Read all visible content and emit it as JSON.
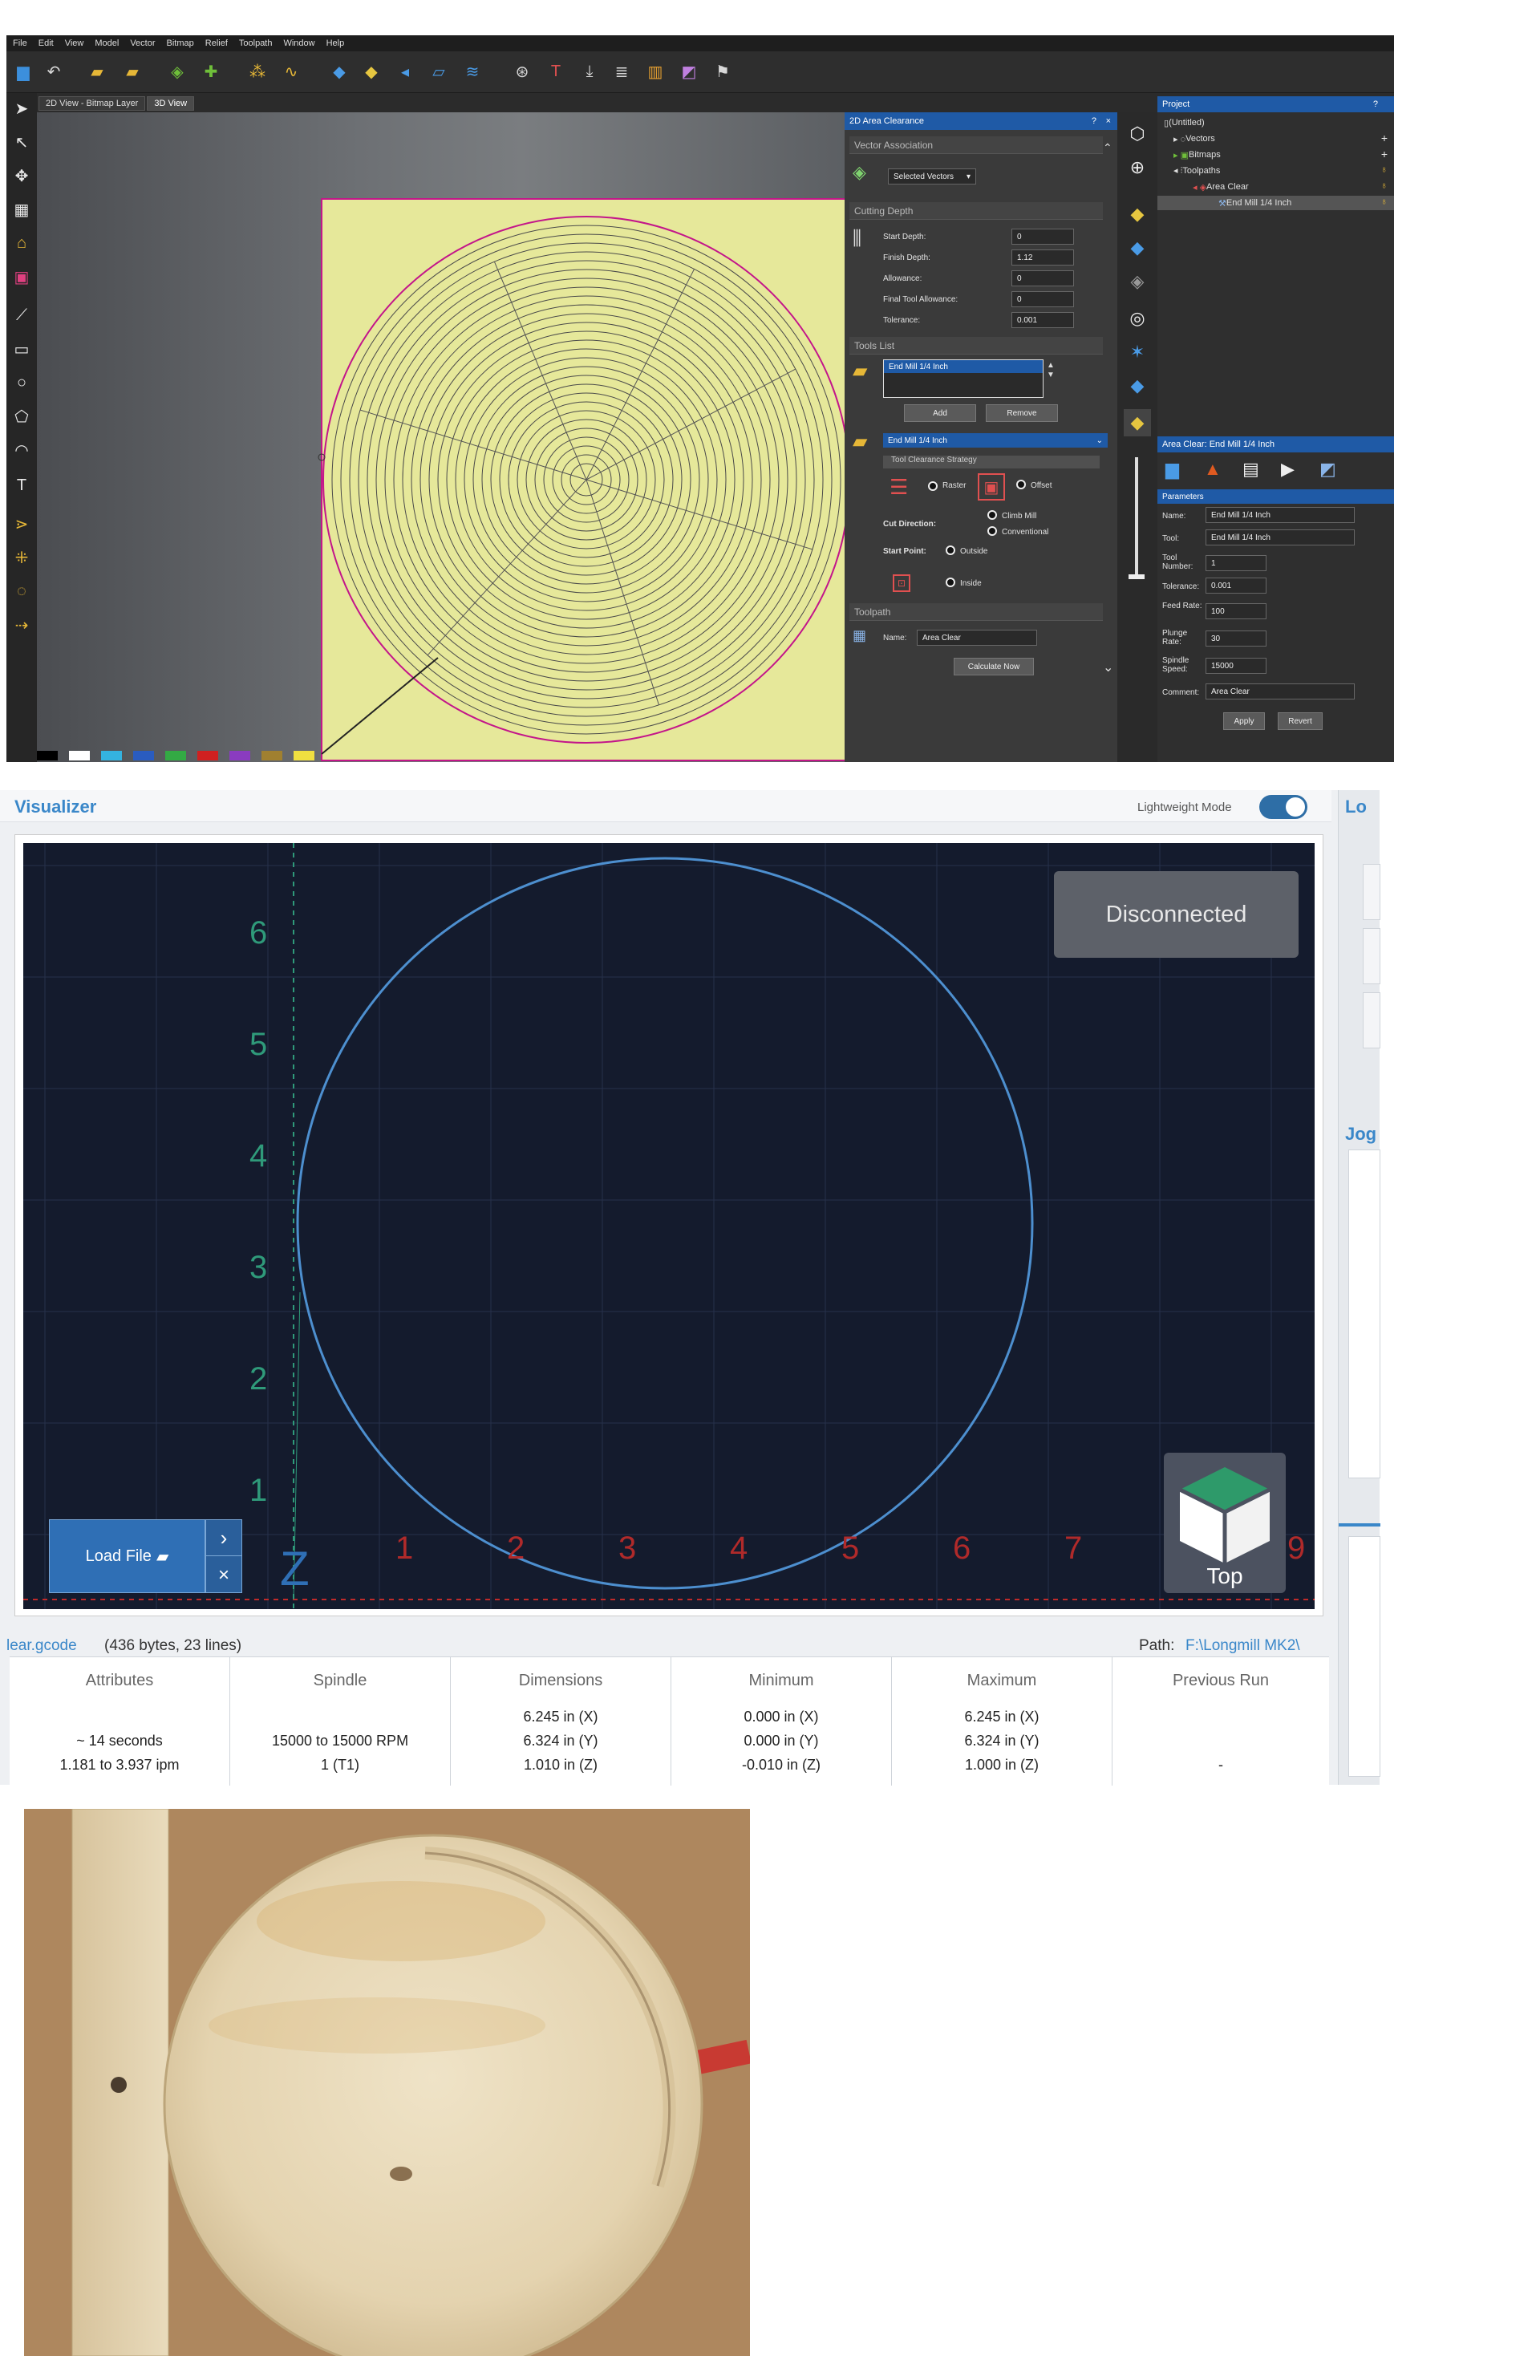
{
  "app": {
    "menu": [
      "File",
      "Edit",
      "View",
      "Model",
      "Vector",
      "Bitmap",
      "Relief",
      "Toolpath",
      "Window",
      "Help"
    ],
    "view_tabs": [
      "2D View - Bitmap Layer",
      "3D View"
    ],
    "area_clearance": {
      "title": "2D Area Clearance",
      "help": "?",
      "close": "×",
      "vector_association": "Vector Association",
      "selected_vectors": "Selected Vectors",
      "cutting_depth": "Cutting Depth",
      "fields": [
        {
          "label": "Start Depth:",
          "value": "0"
        },
        {
          "label": "Finish Depth:",
          "value": "1.12"
        },
        {
          "label": "Allowance:",
          "value": "0"
        },
        {
          "label": "Final Tool Allowance:",
          "value": "0"
        },
        {
          "label": "Tolerance:",
          "value": "0.001"
        }
      ],
      "tools_list": "Tools List",
      "tool_item": "End Mill 1/4 Inch",
      "add": "Add",
      "remove": "Remove",
      "tool_header": "End Mill 1/4 Inch",
      "strategy": "Tool Clearance Strategy",
      "raster": "Raster",
      "offset": "Offset",
      "cut_direction": "Cut Direction:",
      "climb_mill": "Climb Mill",
      "conventional": "Conventional",
      "start_point": "Start Point:",
      "outside": "Outside",
      "inside": "Inside",
      "toolpath": "Toolpath",
      "name_label": "Name:",
      "name_value": "Area Clear",
      "calculate": "Calculate Now"
    },
    "project": {
      "title": "Project",
      "help": "?",
      "items": [
        "(Untitled)",
        "Vectors",
        "Bitmaps",
        "Toolpaths",
        "Area Clear",
        "End Mill 1/4 Inch"
      ]
    },
    "params": {
      "title": "Area Clear: End Mill 1/4 Inch",
      "section": "Parameters",
      "rows": [
        {
          "label": "Name:",
          "value": "End Mill 1/4 Inch"
        },
        {
          "label": "Tool:",
          "value": "End Mill 1/4 Inch"
        },
        {
          "label": "Tool Number:",
          "value": "1"
        },
        {
          "label": "Tolerance:",
          "value": "0.001"
        },
        {
          "label": "Feed Rate:",
          "value": "100"
        },
        {
          "label": "Plunge Rate:",
          "value": "30"
        },
        {
          "label": "Spindle Speed:",
          "value": "15000"
        },
        {
          "label": "Comment:",
          "value": "Area Clear"
        }
      ],
      "apply": "Apply",
      "revert": "Revert"
    },
    "colors": {
      "accent": "#1f5aa6",
      "material": "#e6e89a",
      "toolpath": "#c3168a"
    }
  },
  "visualizer": {
    "title": "Visualizer",
    "lightweight_mode": "Lightweight Mode",
    "lightweight_on": true,
    "status": "Disconnected",
    "load_file": "Load File",
    "cube_label": "Top",
    "y_ticks": [
      "1",
      "2",
      "3",
      "4",
      "5",
      "6"
    ],
    "x_ticks": [
      "1",
      "2",
      "3",
      "4",
      "5",
      "6",
      "7",
      "8",
      "9"
    ],
    "file_name": "lear.gcode",
    "file_info": "(436 bytes, 23 lines)",
    "path_label": "Path:",
    "path_value": "F:\\Longmill MK2\\",
    "side_partial": [
      "Lo",
      "Jog"
    ],
    "columns": [
      {
        "header": "Attributes",
        "lines": [
          "",
          "~ 14 seconds",
          "1.181 to 3.937 ipm"
        ]
      },
      {
        "header": "Spindle",
        "lines": [
          "",
          "15000 to 15000 RPM",
          "1 (T1)"
        ]
      },
      {
        "header": "Dimensions",
        "lines": [
          "6.245 in (X)",
          "6.324 in (Y)",
          "1.010 in (Z)"
        ]
      },
      {
        "header": "Minimum",
        "lines": [
          "0.000 in (X)",
          "0.000 in (Y)",
          "-0.010 in (Z)"
        ]
      },
      {
        "header": "Maximum",
        "lines": [
          "6.245 in (X)",
          "6.324 in (Y)",
          "1.000 in (Z)"
        ]
      },
      {
        "header": "Previous Run",
        "lines": [
          "",
          "",
          "-"
        ]
      }
    ]
  }
}
